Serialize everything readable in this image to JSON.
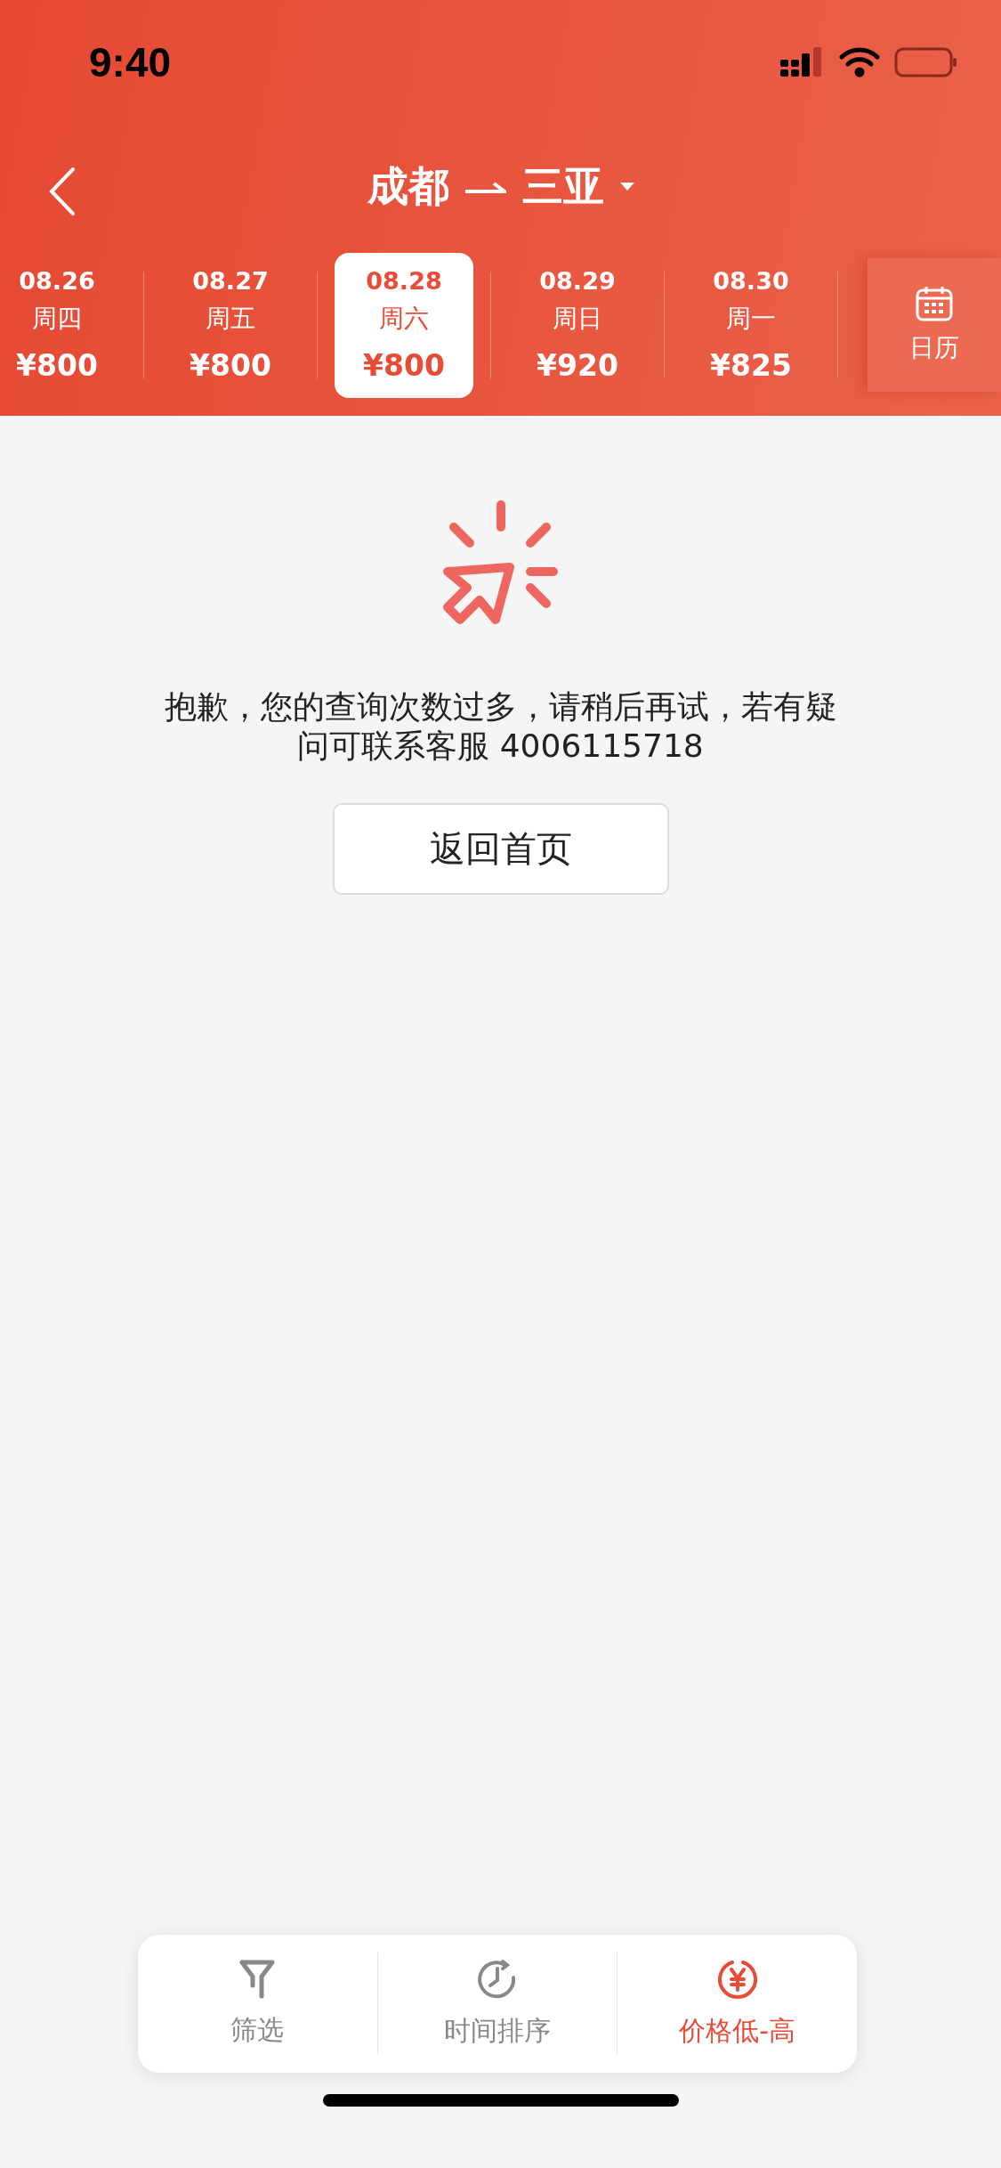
{
  "status_bar": {
    "time": "9:40"
  },
  "header": {
    "from": "成都",
    "to": "三亚"
  },
  "dates": [
    {
      "date": "08.26",
      "weekday": "周四",
      "price": "¥800",
      "selected": false
    },
    {
      "date": "08.27",
      "weekday": "周五",
      "price": "¥800",
      "selected": false
    },
    {
      "date": "08.28",
      "weekday": "周六",
      "price": "¥800",
      "selected": true
    },
    {
      "date": "08.29",
      "weekday": "周日",
      "price": "¥920",
      "selected": false
    },
    {
      "date": "08.30",
      "weekday": "周一",
      "price": "¥825",
      "selected": false
    }
  ],
  "calendar_button": {
    "label": "日历"
  },
  "message": "抱歉，您的查询次数过多，请稍后再试，若有疑问可联系客服 4006115718",
  "home_button": {
    "label": "返回首页"
  },
  "toolbar": [
    {
      "kind": "filter",
      "label": "筛选",
      "selected": false
    },
    {
      "kind": "time",
      "label": "时间排序",
      "selected": false
    },
    {
      "kind": "price",
      "label": "价格低-高",
      "selected": true
    }
  ]
}
